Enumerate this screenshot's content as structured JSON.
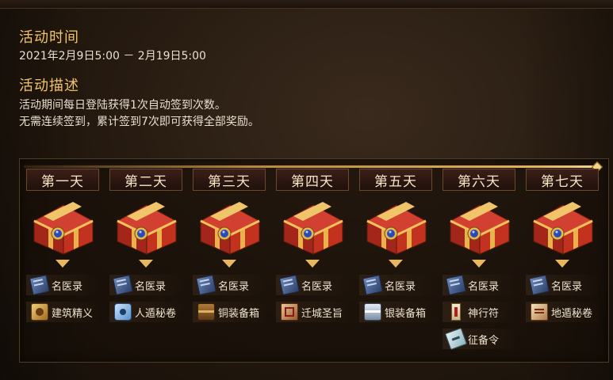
{
  "activity": {
    "time_title": "活动时间",
    "time_range": "2021年2月9日5:00 － 2月19日5:00",
    "desc_title": "活动描述",
    "desc_line1": "活动期间每日登陆获得1次自动签到次数。",
    "desc_line2": "无需连续签到，累计签到7次即可获得全部奖励。"
  },
  "days": [
    {
      "label": "第一天",
      "items": [
        {
          "name": "名医录",
          "icon": "book-icon"
        },
        {
          "name": "建筑精义",
          "icon": "scroll-icon"
        }
      ]
    },
    {
      "label": "第二天",
      "items": [
        {
          "name": "名医录",
          "icon": "book-icon"
        },
        {
          "name": "人遁秘卷",
          "icon": "scroll-icon"
        }
      ]
    },
    {
      "label": "第三天",
      "items": [
        {
          "name": "名医录",
          "icon": "book-icon"
        },
        {
          "name": "铜装备箱",
          "icon": "chest-icon"
        }
      ]
    },
    {
      "label": "第四天",
      "items": [
        {
          "name": "名医录",
          "icon": "book-icon"
        },
        {
          "name": "迁城圣旨",
          "icon": "edict-icon"
        }
      ]
    },
    {
      "label": "第五天",
      "items": [
        {
          "name": "名医录",
          "icon": "book-icon"
        },
        {
          "name": "银装备箱",
          "icon": "chest-icon"
        }
      ]
    },
    {
      "label": "第六天",
      "items": [
        {
          "name": "名医录",
          "icon": "book-icon"
        },
        {
          "name": "神行符",
          "icon": "talisman-icon"
        },
        {
          "name": "征备令",
          "icon": "order-icon"
        }
      ]
    },
    {
      "label": "第七天",
      "items": [
        {
          "name": "名医录",
          "icon": "book-icon"
        },
        {
          "name": "地遁秘卷",
          "icon": "scroll-icon"
        }
      ]
    }
  ]
}
